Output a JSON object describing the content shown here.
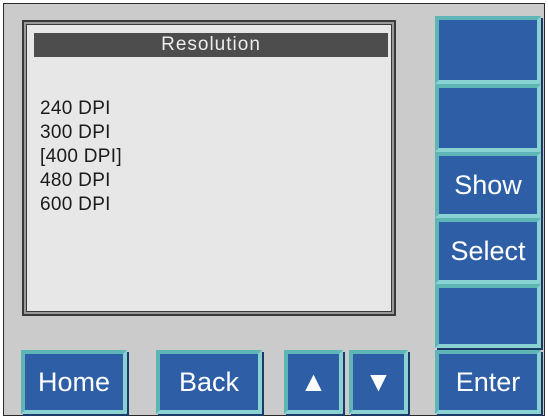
{
  "screen": {
    "title": "Resolution",
    "options": [
      "240 DPI",
      "300 DPI",
      "[400 DPI]",
      "480 DPI",
      "600 DPI"
    ],
    "selected_index": 2
  },
  "side_buttons": [
    {
      "label": ""
    },
    {
      "label": ""
    },
    {
      "label": "Show"
    },
    {
      "label": "Select"
    },
    {
      "label": ""
    },
    {
      "label": "Enter"
    }
  ],
  "bottom_buttons": {
    "home": "Home",
    "back": "Back",
    "up_glyph": "▲",
    "down_glyph": "▼"
  },
  "colors": {
    "button_fill": "#2e5fa6",
    "button_border": "#5db5b5",
    "panel": "#cbcbcb",
    "screen": "#e7e7e7",
    "title_bar": "#4d4d4d"
  }
}
